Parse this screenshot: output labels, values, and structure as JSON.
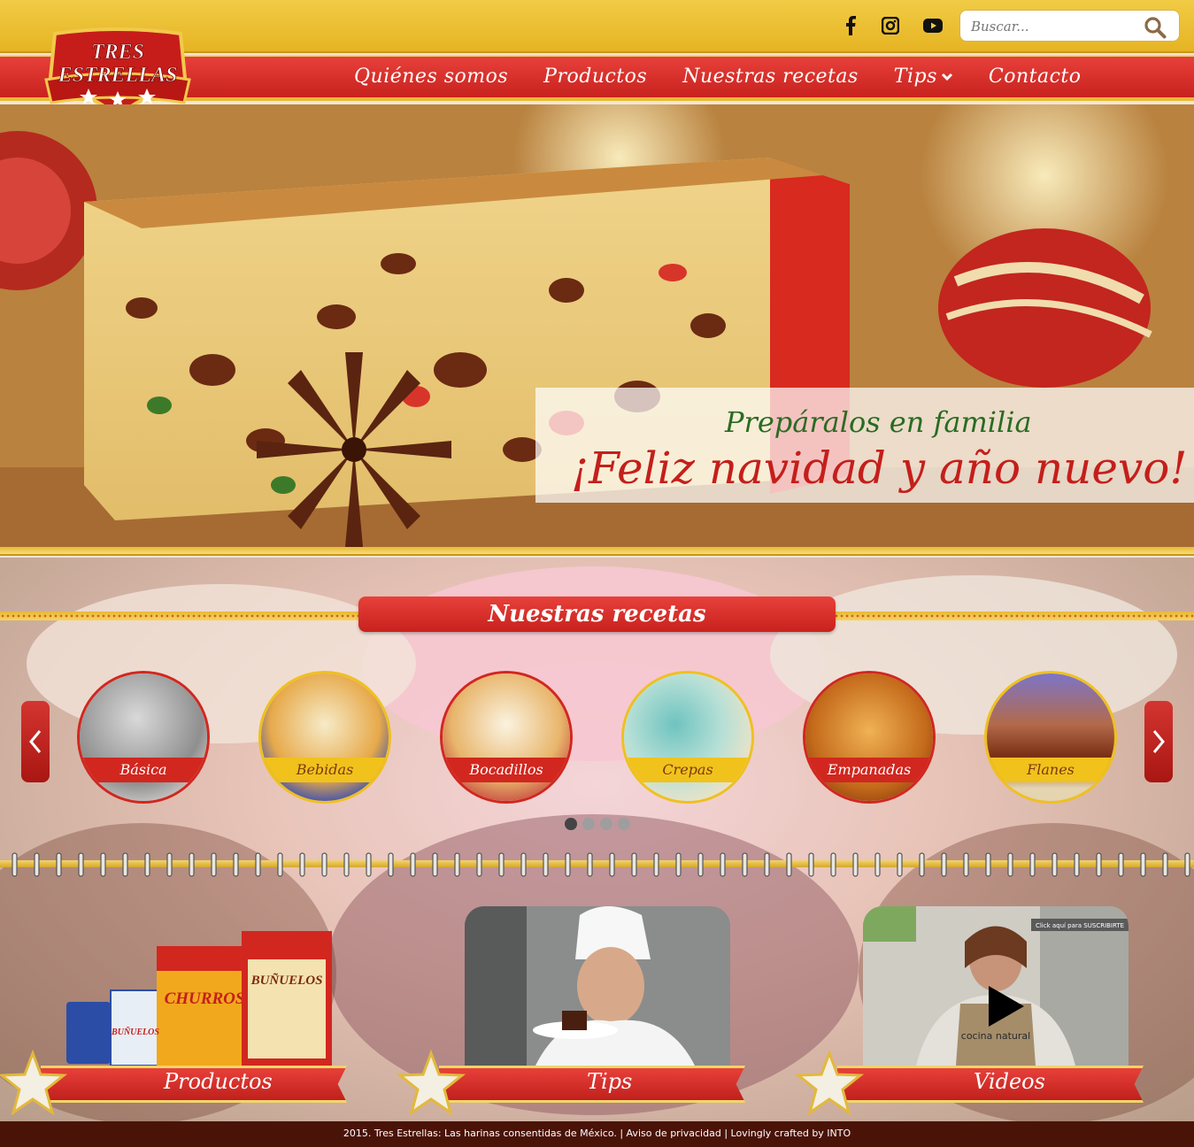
{
  "search": {
    "placeholder": "Buscar..."
  },
  "social": [
    "facebook-icon",
    "instagram-icon",
    "youtube-icon"
  ],
  "logo": {
    "line1": "TRES",
    "line2": "ESTRELLAS"
  },
  "nav": {
    "items": [
      "Quiénes somos",
      "Productos",
      "Nuestras recetas",
      "Tips",
      "Contacto"
    ]
  },
  "hero": {
    "subtitle": "Prepáralos en familia",
    "title": "¡Feliz navidad y año nuevo!"
  },
  "recipes": {
    "title": "Nuestras recetas",
    "items": [
      {
        "label": "Básica",
        "style": "red"
      },
      {
        "label": "Bebidas",
        "style": "yel"
      },
      {
        "label": "Bocadillos",
        "style": "red"
      },
      {
        "label": "Crepas",
        "style": "yel"
      },
      {
        "label": "Empanadas",
        "style": "red"
      },
      {
        "label": "Flanes",
        "style": "yel"
      }
    ],
    "pager_count": 4,
    "pager_active": 0
  },
  "cards": {
    "products": {
      "label": "Productos",
      "box1": "CHURROS",
      "box2": "BUÑUELOS",
      "box3": "BUÑUELOS"
    },
    "tips": {
      "label": "Tips"
    },
    "videos": {
      "label": "Videos",
      "banner": "Click aquí para SUSCRIBIRTE",
      "apron": "cocina natural"
    }
  },
  "colors": {
    "red": "#d1271f",
    "yellow": "#f1c21c",
    "gold": "#e9b935",
    "footer": "#4a1308"
  },
  "footer": {
    "text": "2015. Tres Estrellas: Las harinas consentidas de México. | Aviso de privacidad | Lovingly crafted by INTO"
  }
}
